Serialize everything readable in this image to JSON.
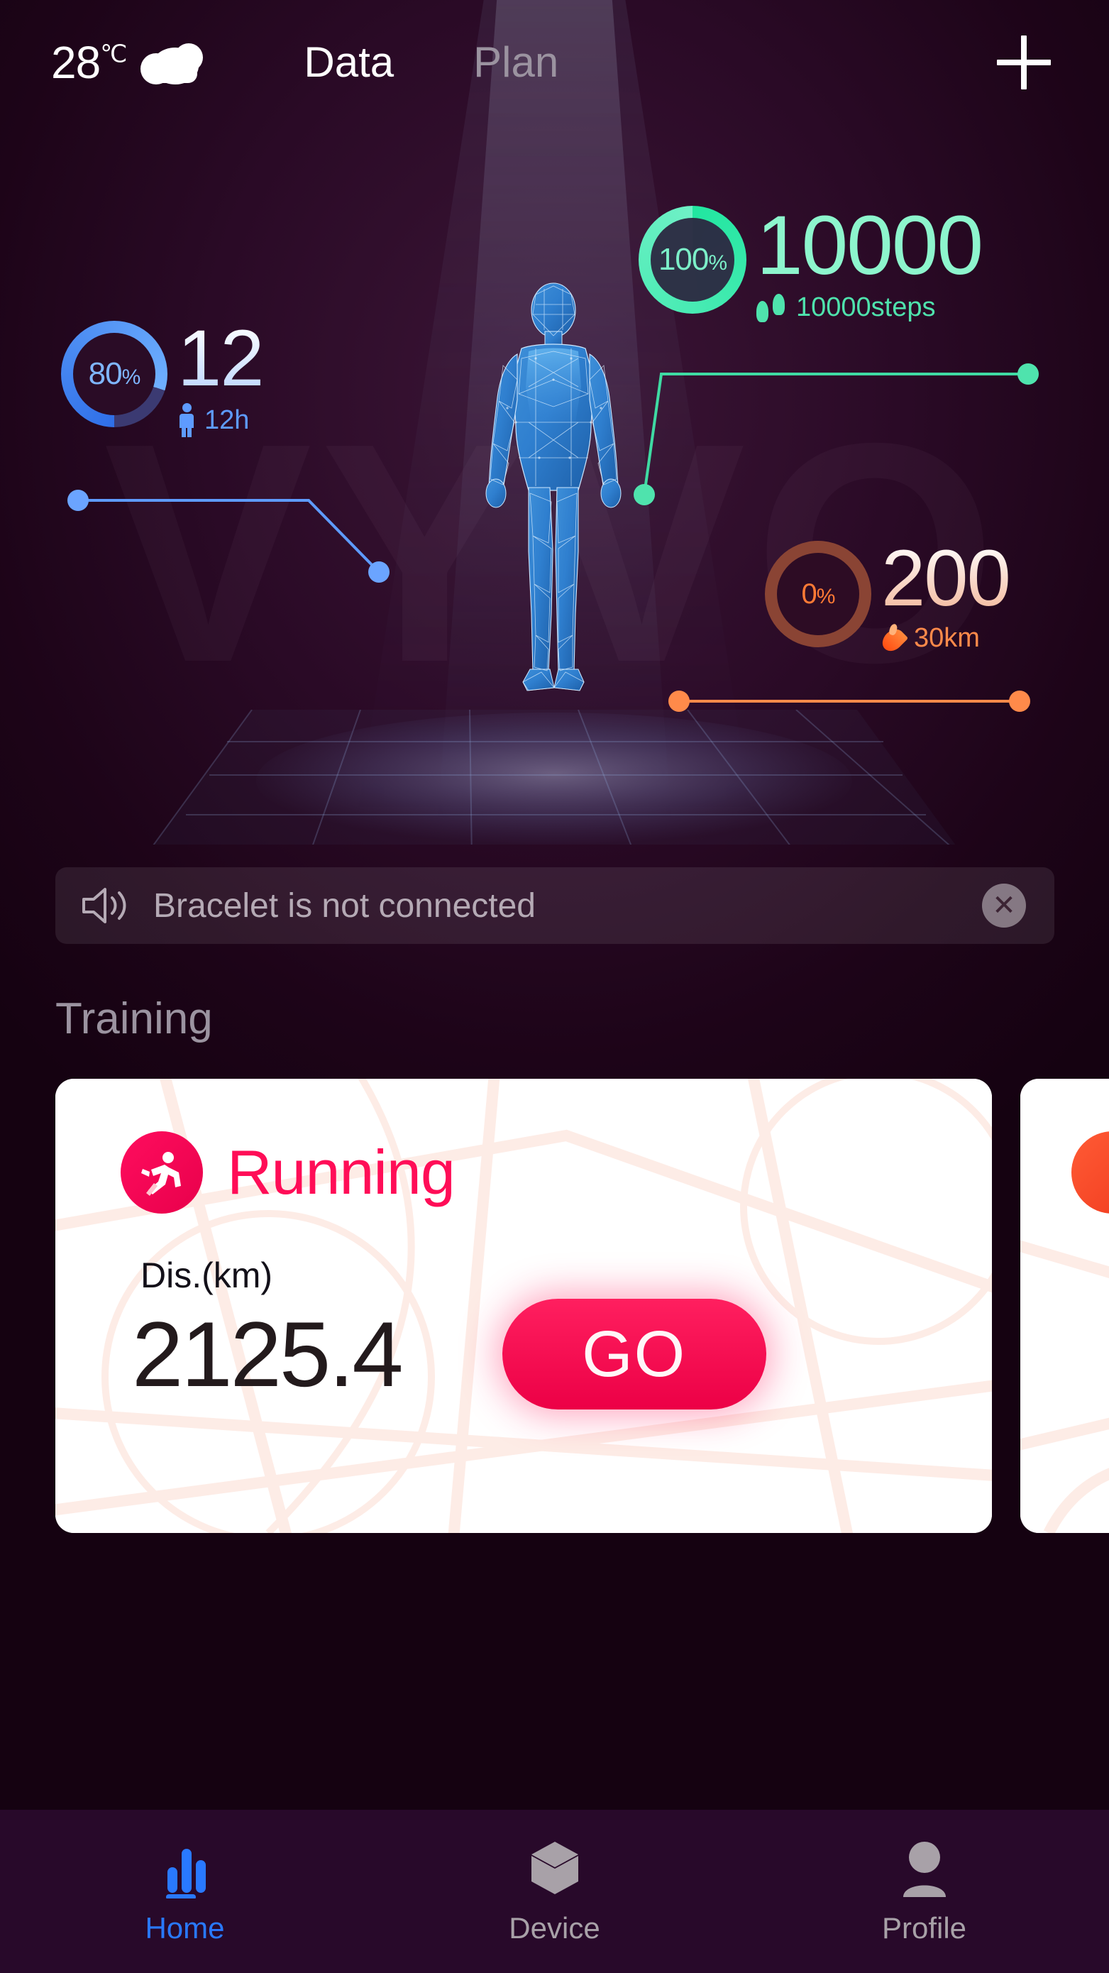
{
  "topbar": {
    "temperature": "28",
    "temperature_unit": "℃",
    "weather_icon": "cloud-icon",
    "tabs": [
      {
        "label": "Data",
        "active": true
      },
      {
        "label": "Plan",
        "active": false
      }
    ],
    "add_button_icon": "plus-icon"
  },
  "watermark": "VYVO",
  "metrics": [
    {
      "id": "hours",
      "percent": "80",
      "percent_symbol": "%",
      "value": "12",
      "sub_label": "12h",
      "sub_icon": "person-icon",
      "color": "#5e9bff",
      "ring_progress": 80
    },
    {
      "id": "steps",
      "percent": "100",
      "percent_symbol": "%",
      "value": "10000",
      "sub_label": "10000steps",
      "sub_icon": "footprints-icon",
      "color": "#21e6a0",
      "ring_progress": 100
    },
    {
      "id": "calories",
      "percent": "0",
      "percent_symbol": "%",
      "value": "200",
      "sub_label": "30km",
      "sub_icon": "flame-icon",
      "color": "#ff7a35",
      "ring_progress": 0
    }
  ],
  "notice": {
    "icon": "speaker-icon",
    "message": "Bracelet is not connected",
    "close_icon": "close-icon"
  },
  "training": {
    "section_title": "Training",
    "cards": [
      {
        "icon": "running-icon",
        "title": "Running",
        "stat_label": "Dis.(km)",
        "stat_value": "2125.4",
        "action_label": "GO",
        "accent": "#ff0d57"
      },
      {
        "icon": "cycling-icon",
        "accent": "#f03a1e"
      }
    ]
  },
  "bottom_nav": [
    {
      "label": "Home",
      "icon": "bar-chart-icon",
      "active": true
    },
    {
      "label": "Device",
      "icon": "cube-icon",
      "active": false
    },
    {
      "label": "Profile",
      "icon": "person-icon",
      "active": false
    }
  ]
}
